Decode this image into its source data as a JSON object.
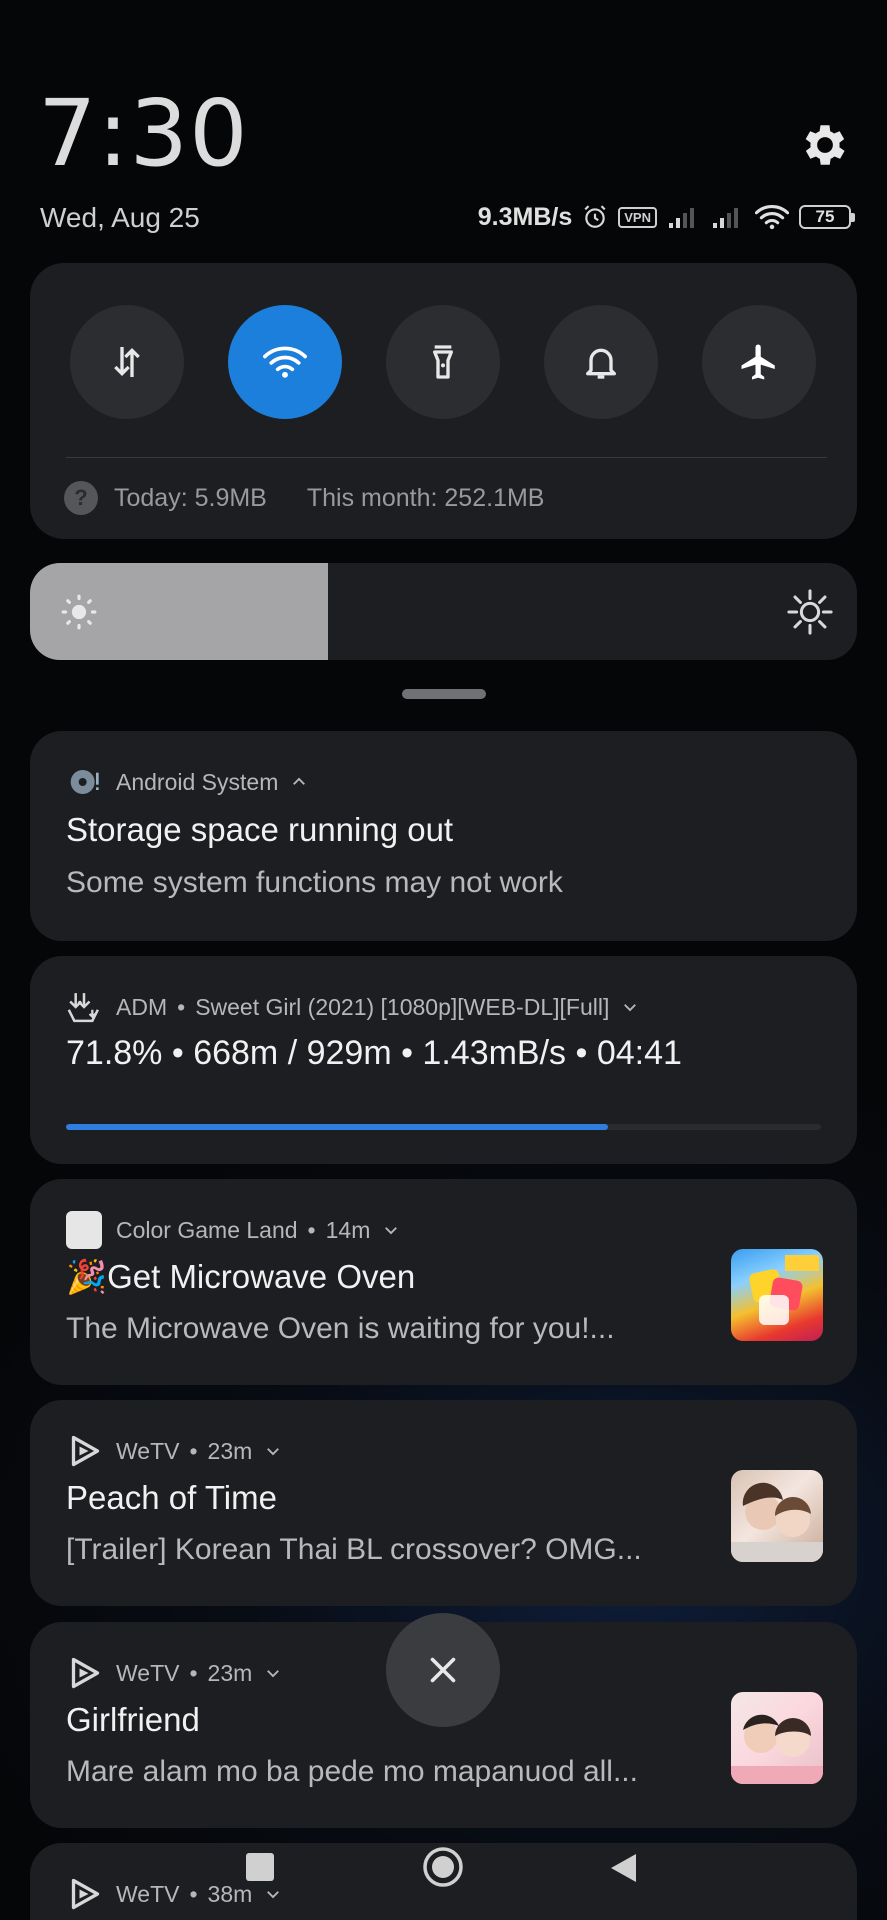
{
  "header": {
    "time": "7:30",
    "date": "Wed, Aug 25",
    "speed": "9.3MB/s",
    "vpn": "VPN",
    "battery": "75"
  },
  "quick_settings": {
    "toggles": [
      {
        "name": "mobile-data",
        "icon": "data-arrows-icon",
        "on": false
      },
      {
        "name": "wifi",
        "icon": "wifi-icon",
        "on": true
      },
      {
        "name": "flashlight",
        "icon": "flashlight-icon",
        "on": false
      },
      {
        "name": "ringer",
        "icon": "bell-icon",
        "on": false
      },
      {
        "name": "airplane",
        "icon": "airplane-icon",
        "on": false
      }
    ],
    "usage_today": "Today: 5.9MB",
    "usage_month": "This month: 252.1MB"
  },
  "brightness": {
    "level": 0.36
  },
  "notifications": [
    {
      "app": "Android System",
      "title": "Storage space running out",
      "text": "Some system functions may not work"
    },
    {
      "app": "ADM",
      "dot": "•",
      "file": "Sweet Girl (2021) [1080p][WEB-DL][Full]",
      "progress_text": "71.8% • 668m / 929m • 1.43mB/s • 04:41",
      "progress": 0.718
    },
    {
      "app": "Color Game Land",
      "dot": "•",
      "time": "14m",
      "title": "🎉Get Microwave Oven",
      "text": "The Microwave Oven is waiting for you!..."
    },
    {
      "app": "WeTV",
      "dot": "•",
      "time": "23m",
      "title": "Peach of Time",
      "text": "[Trailer] Korean Thai BL crossover? OMG..."
    },
    {
      "app": "WeTV",
      "dot": "•",
      "time": "23m",
      "title": "Girlfriend",
      "text": "Mare alam mo ba pede mo mapanuod all..."
    },
    {
      "app": "WeTV",
      "dot": "•",
      "time": "38m"
    }
  ],
  "colors": {
    "accent": "#1b7fdb",
    "progress": "#2e7de0",
    "card": "#1d1e21"
  }
}
